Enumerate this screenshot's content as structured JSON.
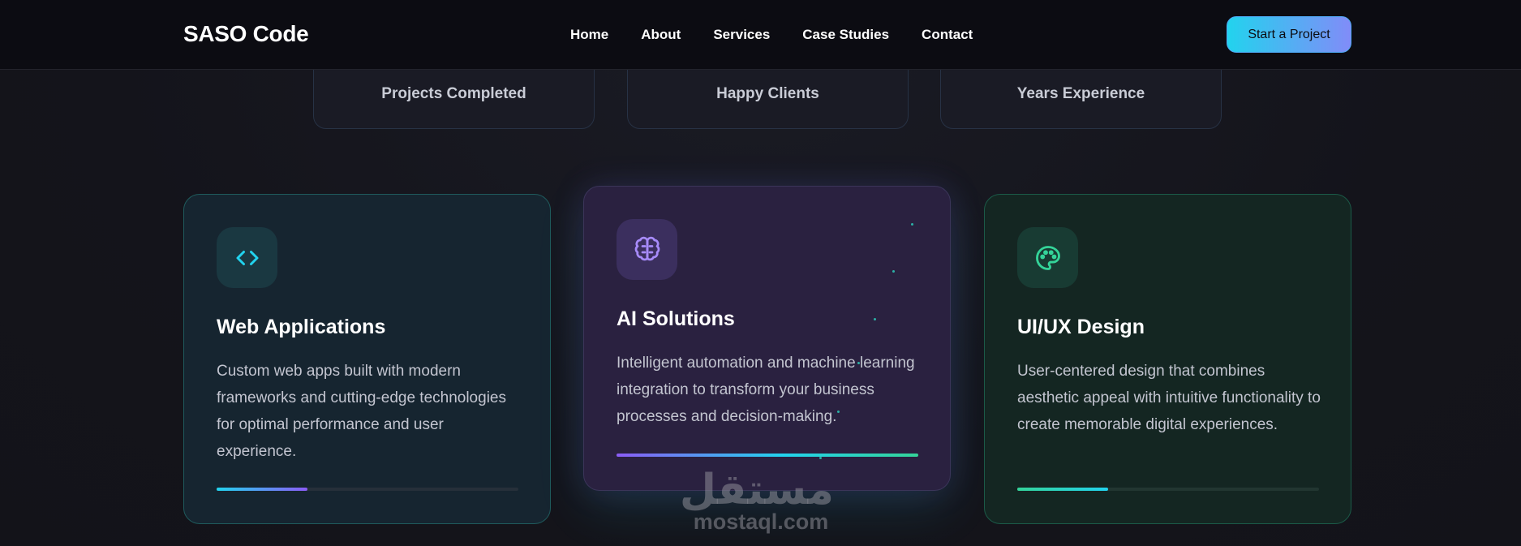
{
  "nav": {
    "logo": "SASO Code",
    "links": [
      "Home",
      "About",
      "Services",
      "Case Studies",
      "Contact"
    ],
    "cta": "Start a Project"
  },
  "stats": [
    {
      "label": "Projects Completed"
    },
    {
      "label": "Happy Clients"
    },
    {
      "label": "Years Experience"
    }
  ],
  "services": [
    {
      "icon": "code-icon",
      "title": "Web Applications",
      "description": "Custom web apps built with modern frameworks and cutting-edge technologies for optimal performance and user experience.",
      "progress": 0.3,
      "accent": "#22d3ee"
    },
    {
      "icon": "brain-icon",
      "title": "AI Solutions",
      "description": "Intelligent automation and machine learning integration to transform your business processes and decision-making.",
      "progress": 1.0,
      "accent": "#8b5cf6"
    },
    {
      "icon": "palette-icon",
      "title": "UI/UX Design",
      "description": "User-centered design that combines aesthetic appeal with intuitive functionality to create memorable digital experiences.",
      "progress": 0.3,
      "accent": "#34d399"
    }
  ],
  "watermark": {
    "arabic": "مستقل",
    "latin": "mostaql.com"
  }
}
